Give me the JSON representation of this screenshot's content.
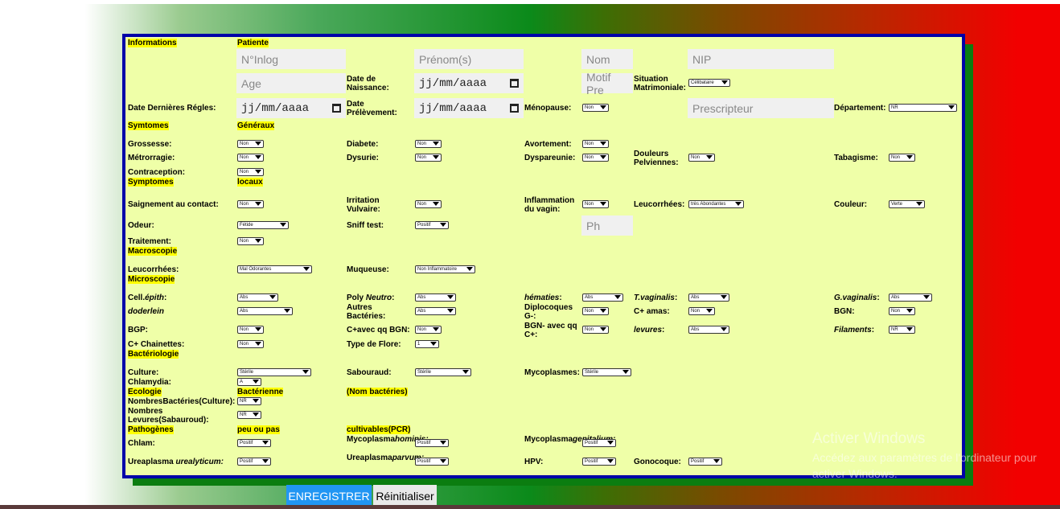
{
  "section_headers": {
    "informations": "Informations",
    "patiente": "Patiente",
    "symtomes": "Symtomes",
    "generaux": "Généraux",
    "symptomes": "Symptomes",
    "locaux": "locaux",
    "macroscopie": "Macroscopie",
    "microscopie": "Microscopie",
    "bacteriologie": "Bactériologie",
    "ecologie": "Ecologie",
    "bacterienne": "Bactérienne",
    "nom_bacteries": "(Nom bactéries)",
    "pathogenes": "Pathogènes",
    "peu_ou_pas": "peu ou pas",
    "cultivables": "cultivables(PCR)"
  },
  "fields": {
    "ninlog": "N°Inlog",
    "prenom": "Prénom(s)",
    "nom": "Nom",
    "nip": "NIP",
    "age": "Age",
    "motif": "Motif Pre",
    "prescripteur": "Prescripteur",
    "ph": "Ph",
    "date_placeholder": "jj/mm/aaaa"
  },
  "labels": {
    "date_naissance": "Date de Naissance:",
    "situation": "Situation Matrimoniale:",
    "ddr": "Date Dernières Régles:",
    "date_prelevement": "Date Prélèvement:",
    "menopause": "Ménopause:",
    "departement": "Département:",
    "grossesse": "Grossesse:",
    "diabete": "Diabete:",
    "avortement": "Avortement:",
    "metrorragie": "Métrorragie:",
    "dysurie": "Dysurie:",
    "dyspareunie": "Dyspareunie:",
    "douleurs": "Douleurs Pelviennes:",
    "tabagisme": "Tabagisme:",
    "contraception": "Contraception:",
    "saignement": "Saignement au contact:",
    "irritation": "Irritation Vulvaire:",
    "inflammation": "Inflammation du vagin:",
    "leucorrhees": "Leucorrhées:",
    "couleur": "Couleur:",
    "odeur": "Odeur:",
    "sniff": "Sniff test:",
    "traitement": "Traitement:",
    "leucorrhees2": "Leucorrhées:",
    "muqueuse": "Muqueuse:",
    "cell": "Cell.",
    "cell_it": "épith",
    "poly": "Poly ",
    "poly_it": "Neutro",
    "hematies": "hématies",
    "tvag": "T.vaginalis",
    "gvag": "G.vaginalis",
    "doderlein": "doderlein",
    "autres": "Autres Bactéries:",
    "diplo": "Diplocoques G-:",
    "camas": "C+ amas:",
    "bgn": "BGN:",
    "bgp": "BGP:",
    "cavec": "C+avec qq BGN:",
    "bgnavec": "BGN- avec qq C+:",
    "levures": "levures",
    "filaments": "Filaments",
    "chainettes": "C+ Chainettes:",
    "flore": "Type de Flore:",
    "culture": "Culture:",
    "sabouraud": "Sabouraud:",
    "mycoplasmes": "Mycoplasmes:",
    "chlamydia": "Chlamydia:",
    "nombres_bact": "NombresBactéries(Culture):",
    "nombres_lev": "Nombres Levures(Sabauroud):",
    "chlam": "Chlam:",
    "myco_hom": "Mycoplasma",
    "myco_hom_it": "hominis:",
    "myco_gen": "Mycoplasma",
    "myco_gen_it": "genitalium:",
    "urea_u": "Ureaplasma ",
    "urea_u_it": "urealyticum:",
    "urea_p": "Ureaplasma",
    "urea_p_it": "parvum:",
    "hpv": "HPV:",
    "gonocoque": "Gonocoque:"
  },
  "selects": {
    "situation": "Célibataire",
    "menopause": "Non",
    "departement": "NR",
    "grossesse": "Non",
    "diabete": "Non",
    "avortement": "Non",
    "metrorragie": "Non",
    "dysurie": "Non",
    "dyspareunie": "Non",
    "douleurs": "Non",
    "tabagisme": "Non",
    "contraception": "Non",
    "saignement": "Non",
    "irritation": "Non",
    "inflammation": "Non",
    "leucorrhees": "très Abondantes",
    "couleur": "Verte",
    "odeur": "Fétide",
    "sniff": "Positif",
    "traitement": "Non",
    "leucorrhees2": "Mal Odorantes",
    "muqueuse": "Non Inflammatoire",
    "cell": "Abs",
    "poly": "Abs",
    "hematies": "Abs",
    "tvag": "Abs",
    "gvag": "Abs",
    "doderlein": "Abs",
    "autres": "Abs",
    "diplo": "Non",
    "camas": "Non",
    "bgn": "Non",
    "bgp": "Non",
    "cavec": "Non",
    "bgnavec": "Non",
    "levures": "Abs",
    "filaments": "NR",
    "chainettes": "Non",
    "flore": "1",
    "culture": "Stérile",
    "sabouraud": "Stérile",
    "mycoplasmes": "Stérile",
    "chlamydia": "A",
    "nombres_bact": "NR",
    "nombres_lev": "NR",
    "chlam": "Positif",
    "myco_hom": "Positif",
    "myco_gen": "Positif",
    "urea_u": "Positif",
    "urea_p": "Positif",
    "hpv": "Positif",
    "gonocoque": "Positif"
  },
  "buttons": {
    "save": "ENREGISTRER",
    "reset": "Réinitialiser"
  },
  "watermark": {
    "title": "Activer Windows",
    "sub": "Accédez aux paramètres de l'ordinateur pour activer Windows."
  }
}
